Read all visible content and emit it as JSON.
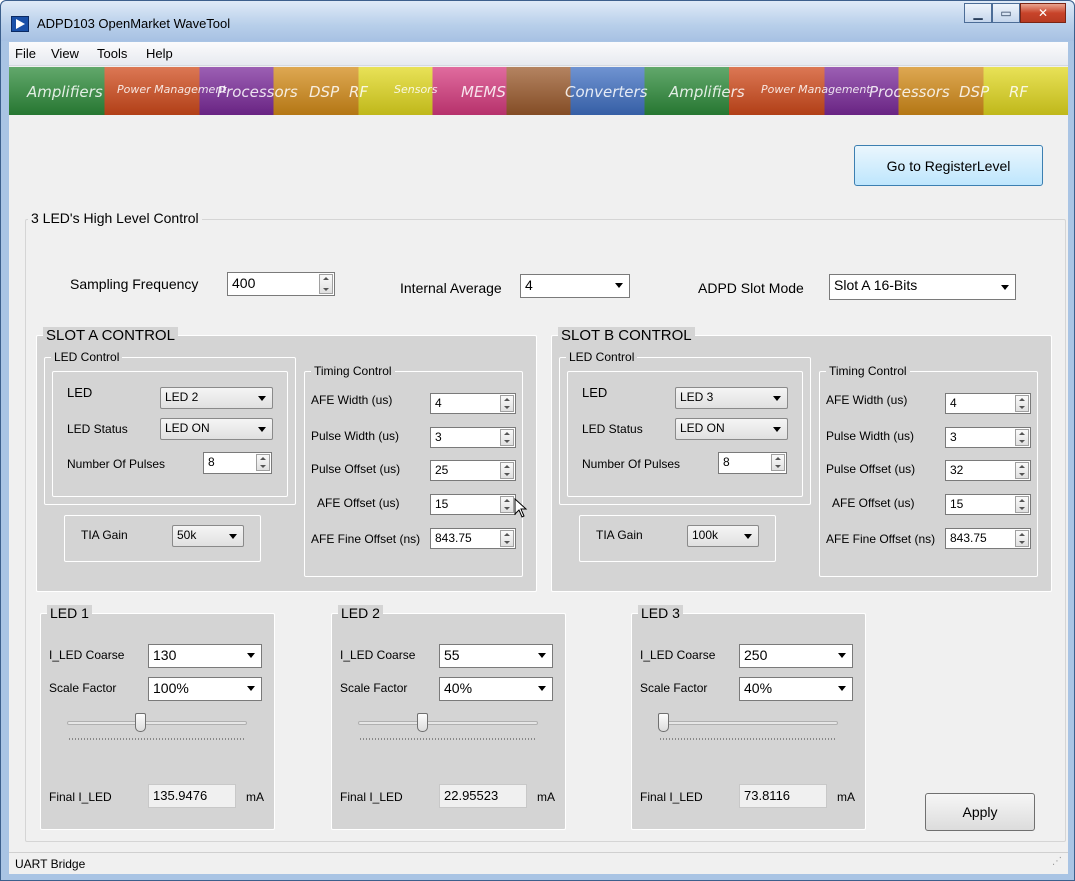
{
  "window": {
    "title": "ADPD103 OpenMarket WaveTool"
  },
  "menu": [
    "File",
    "View",
    "Tools",
    "Help"
  ],
  "banner": [
    "Amplifiers",
    "Power Management",
    "Processors",
    "DSP",
    "RF",
    "Sensors",
    "MEMS",
    "Converters",
    "Amplifiers",
    "Power Management",
    "Processors",
    "DSP",
    "RF"
  ],
  "goto_button": "Go to RegisterLevel",
  "high_level": {
    "title": "3 LED's High Level Control",
    "sampling_label": "Sampling Frequency",
    "sampling_value": "400",
    "internal_avg_label": "Internal Average",
    "internal_avg_value": "4",
    "slot_mode_label": "ADPD Slot Mode",
    "slot_mode_value": "Slot A 16-Bits"
  },
  "slot_a": {
    "title": "SLOT A CONTROL",
    "led_control_title": "LED Control",
    "led_label": "LED",
    "led_value": "LED 2",
    "led_status_label": "LED Status",
    "led_status_value": "LED ON",
    "pulses_label": "Number Of Pulses",
    "pulses_value": "8",
    "tia_label": "TIA Gain",
    "tia_value": "50k",
    "timing_title": "Timing Control",
    "afe_width_label": "AFE Width (us)",
    "afe_width_value": "4",
    "pulse_width_label": "Pulse Width (us)",
    "pulse_width_value": "3",
    "pulse_offset_label": "Pulse Offset (us)",
    "pulse_offset_value": "25",
    "afe_offset_label": "AFE Offset (us)",
    "afe_offset_value": "15",
    "afe_fine_label": "AFE Fine Offset (ns)",
    "afe_fine_value": "843.75"
  },
  "slot_b": {
    "title": "SLOT B CONTROL",
    "led_control_title": "LED Control",
    "led_label": "LED",
    "led_value": "LED 3",
    "led_status_label": "LED Status",
    "led_status_value": "LED ON",
    "pulses_label": "Number Of Pulses",
    "pulses_value": "8",
    "tia_label": "TIA Gain",
    "tia_value": "100k",
    "timing_title": "Timing Control",
    "afe_width_label": "AFE Width (us)",
    "afe_width_value": "4",
    "pulse_width_label": "Pulse Width (us)",
    "pulse_width_value": "3",
    "pulse_offset_label": "Pulse Offset (us)",
    "pulse_offset_value": "32",
    "afe_offset_label": "AFE Offset (us)",
    "afe_offset_value": "15",
    "afe_fine_label": "AFE Fine Offset (ns)",
    "afe_fine_value": "843.75"
  },
  "led1": {
    "title": "LED 1",
    "coarse_label": "I_LED Coarse",
    "coarse_value": "130",
    "scale_label": "Scale Factor",
    "scale_value": "100%",
    "slider_fraction": 0.4,
    "final_label": "Final I_LED",
    "final_value": "135.9476",
    "unit": "mA"
  },
  "led2": {
    "title": "LED 2",
    "coarse_label": "I_LED Coarse",
    "coarse_value": "55",
    "scale_label": "Scale Factor",
    "scale_value": "40%",
    "slider_fraction": 0.35,
    "final_label": "Final I_LED",
    "final_value": "22.95523",
    "unit": "mA"
  },
  "led3": {
    "title": "LED 3",
    "coarse_label": "I_LED Coarse",
    "coarse_value": "250",
    "scale_label": "Scale Factor",
    "scale_value": "40%",
    "slider_fraction": 0.0,
    "final_label": "Final I_LED",
    "final_value": "73.8116",
    "unit": "mA"
  },
  "apply_button": "Apply",
  "status": "UART Bridge"
}
